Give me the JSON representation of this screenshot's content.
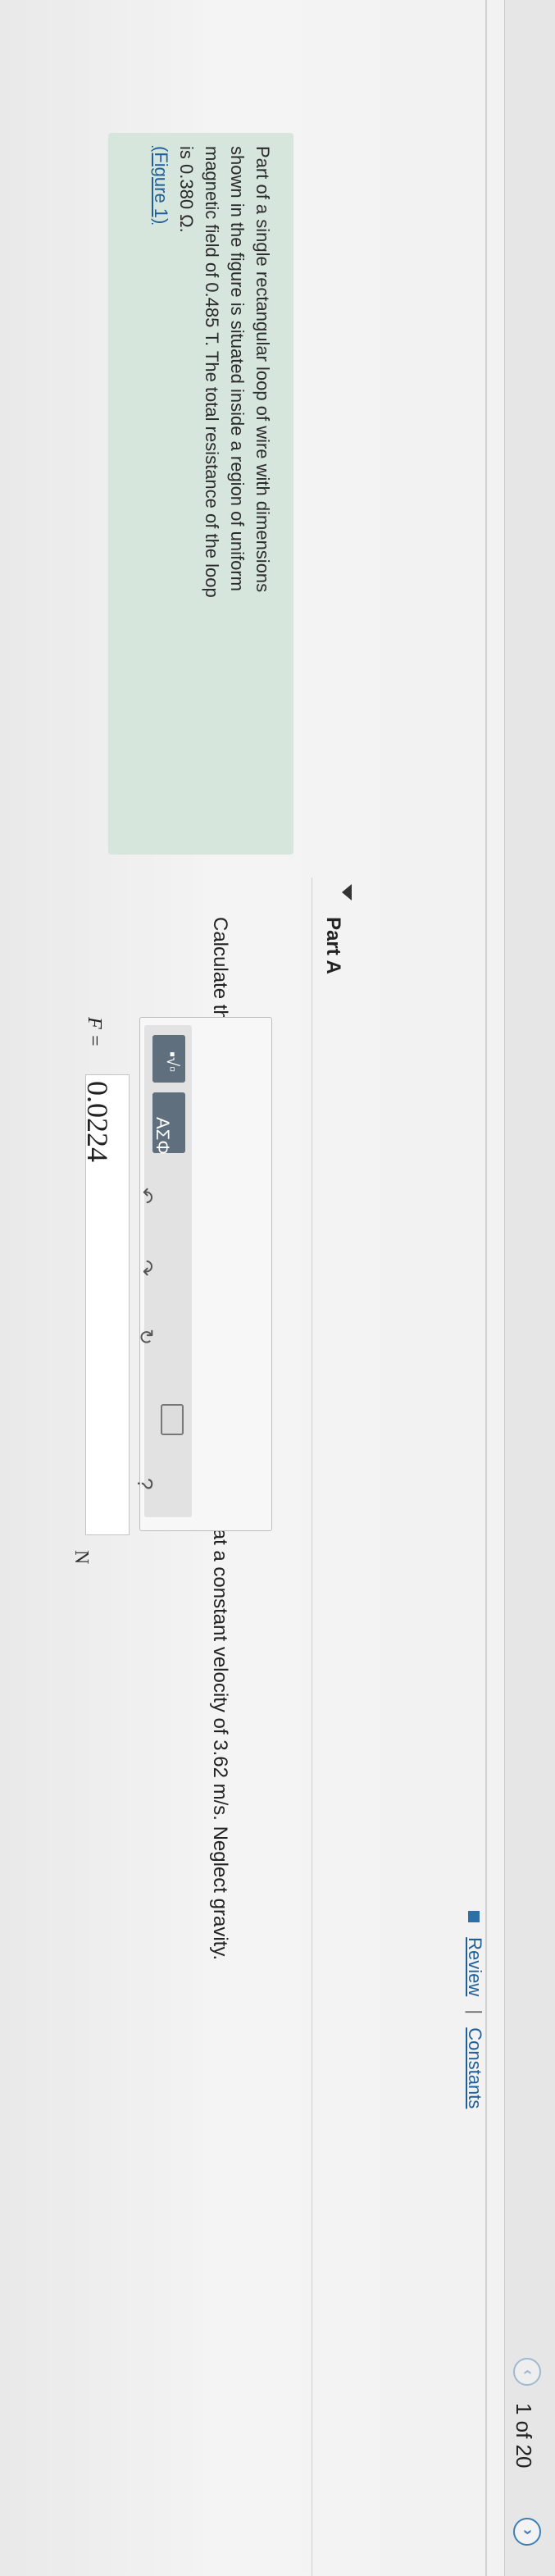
{
  "header": {
    "page_counter": "1 of 20",
    "prev_icon": "chevron-left-icon",
    "next_icon": "chevron-right-icon",
    "review_label": "Review",
    "separator": "|",
    "constants_label": "Constants"
  },
  "problem": {
    "lines": [
      "Part of a single rectangular loop of wire with dimensions",
      "shown in the figure is situated inside a region of uniform",
      "magnetic field of 0.485 T. The total resistance of the loop",
      "is 0.380 Ω."
    ],
    "figure_link": "(Figure 1)"
  },
  "part_a": {
    "title": "Part A",
    "question": "Calculate the force required to pull the loop from the field (to the right) at a constant velocity of 3.62 m/s. Neglect gravity."
  },
  "answer": {
    "label": "F =",
    "value": "0.0224",
    "unit": "N",
    "toolbar": {
      "template_glyph": "▪√▫",
      "symbols_label": "ΑΣΦ",
      "undo_glyph": "↶",
      "redo_glyph": "↷",
      "reset_glyph": "↻",
      "help_glyph": "?"
    }
  },
  "colors": {
    "panel": "#d7e6dc",
    "link": "#1f5f99",
    "toolbar_button": "#5f6f7e"
  }
}
